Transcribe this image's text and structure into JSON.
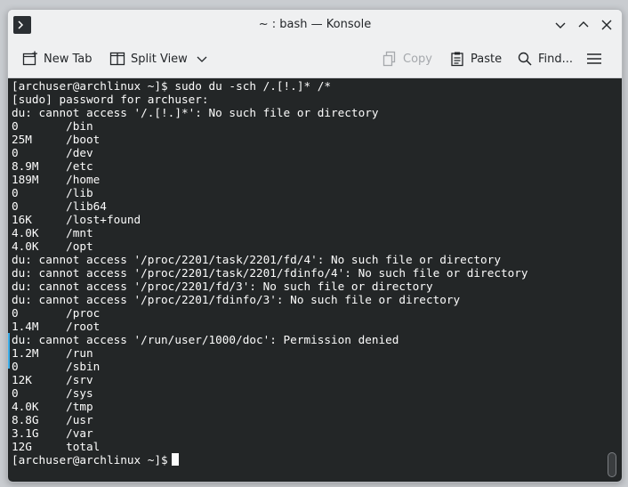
{
  "window": {
    "title": "~ : bash — Konsole"
  },
  "toolbar": {
    "new_tab": "New Tab",
    "split_view": "Split View",
    "copy": "Copy",
    "paste": "Paste",
    "find": "Find..."
  },
  "icons": {
    "app": "terminal-icon",
    "minimize": "chevron-down-icon",
    "maximize": "chevron-up-icon",
    "close": "close-icon",
    "new_tab": "new-tab-icon",
    "split_view": "split-view-icon",
    "dropdown": "chevron-down-icon",
    "copy": "copy-icon",
    "paste": "paste-icon",
    "find": "search-icon",
    "menu": "hamburger-menu-icon"
  },
  "colors": {
    "terminal_bg": "#232627",
    "terminal_fg": "#fcfcfc",
    "chrome_bg": "#eff0f1",
    "accent": "#3daee9"
  },
  "terminal": {
    "lines": [
      "[archuser@archlinux ~]$ sudo du -sch /.[!.]* /*",
      "[sudo] password for archuser:",
      "du: cannot access '/.[!.]*': No such file or directory",
      "0       /bin",
      "25M     /boot",
      "0       /dev",
      "8.9M    /etc",
      "189M    /home",
      "0       /lib",
      "0       /lib64",
      "16K     /lost+found",
      "4.0K    /mnt",
      "4.0K    /opt",
      "du: cannot access '/proc/2201/task/2201/fd/4': No such file or directory",
      "du: cannot access '/proc/2201/task/2201/fdinfo/4': No such file or directory",
      "du: cannot access '/proc/2201/fd/3': No such file or directory",
      "du: cannot access '/proc/2201/fdinfo/3': No such file or directory",
      "0       /proc",
      "1.4M    /root",
      "du: cannot access '/run/user/1000/doc': Permission denied",
      "1.2M    /run",
      "0       /sbin",
      "12K     /srv",
      "0       /sys",
      "4.0K    /tmp",
      "8.8G    /usr",
      "3.1G    /var",
      "12G     total"
    ],
    "prompt": "[archuser@archlinux ~]$"
  }
}
